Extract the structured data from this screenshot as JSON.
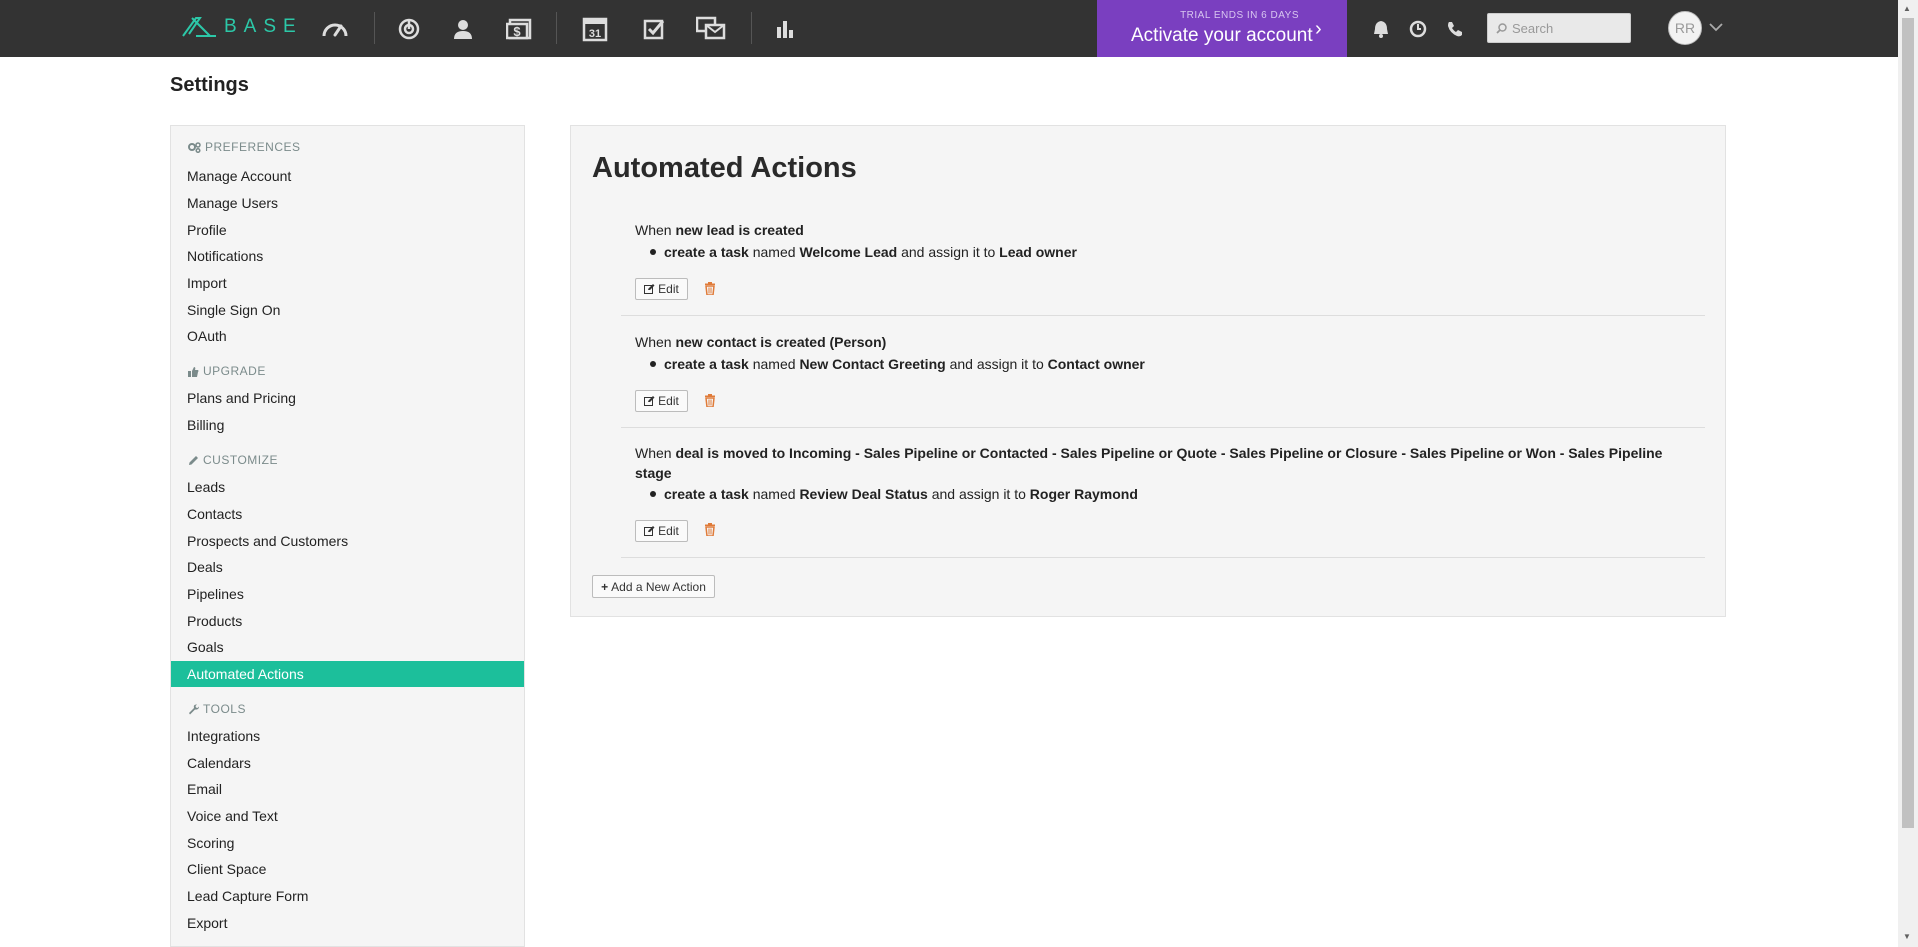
{
  "topbar": {
    "logo_text": "BASE",
    "trial_small": "TRIAL ENDS IN 6 DAYS",
    "trial_big": "Activate your account",
    "trial_chevron": "›",
    "search_placeholder": "Search",
    "avatar_initials": "RR",
    "nav_icons": [
      "dashboard-icon",
      "target-icon",
      "person-icon",
      "deals-icon",
      "calendar-icon",
      "tasks-icon",
      "messages-icon",
      "reports-icon"
    ],
    "calendar_day": "31",
    "right_icons": [
      "bell-icon",
      "clock-icon",
      "phone-icon"
    ]
  },
  "page": {
    "title": "Settings"
  },
  "sidebar": {
    "sections": [
      {
        "label": "PREFERENCES",
        "icon": "gears-icon",
        "items": [
          "Manage Account",
          "Manage Users",
          "Profile",
          "Notifications",
          "Import",
          "Single Sign On",
          "OAuth"
        ]
      },
      {
        "label": "UPGRADE",
        "icon": "thumbs-up-icon",
        "items": [
          "Plans and Pricing",
          "Billing"
        ]
      },
      {
        "label": "CUSTOMIZE",
        "icon": "pencil-icon",
        "items": [
          "Leads",
          "Contacts",
          "Prospects and Customers",
          "Deals",
          "Pipelines",
          "Products",
          "Goals",
          "Automated Actions"
        ]
      },
      {
        "label": "TOOLS",
        "icon": "wrench-icon",
        "items": [
          "Integrations",
          "Calendars",
          "Email",
          "Voice and Text",
          "Scoring",
          "Client Space",
          "Lead Capture Form",
          "Export"
        ]
      }
    ],
    "active_item": "Automated Actions"
  },
  "main": {
    "title": "Automated Actions",
    "actions": [
      {
        "when_prefix": "When ",
        "trigger": "new lead is created",
        "trigger_suffix": "",
        "do_action": "create a task",
        "named_text": " named ",
        "task_name": "Welcome Lead",
        "assign_text": " and assign it to ",
        "assignee": "Lead owner"
      },
      {
        "when_prefix": "When ",
        "trigger": "new contact is created (Person)",
        "trigger_suffix": "",
        "do_action": "create a task",
        "named_text": " named ",
        "task_name": "New Contact Greeting",
        "assign_text": " and assign it to ",
        "assignee": "Contact owner"
      },
      {
        "when_prefix": "When ",
        "trigger": "deal is moved to Incoming - Sales Pipeline or Contacted - Sales Pipeline or Quote - Sales Pipeline or Closure - Sales Pipeline or Won - Sales Pipeline stage",
        "trigger_suffix": "",
        "do_action": "create a task",
        "named_text": " named ",
        "task_name": "Review Deal Status",
        "assign_text": " and assign it to ",
        "assignee": "Roger Raymond"
      }
    ],
    "edit_label": "Edit",
    "add_label": "Add a New Action",
    "add_icon": "+"
  },
  "colors": {
    "topbar_bg": "#333333",
    "brand": "#2cc8a8",
    "trial_bg": "#7a3fc0",
    "active_item": "#1cbf9b",
    "trash": "#e07b39"
  }
}
